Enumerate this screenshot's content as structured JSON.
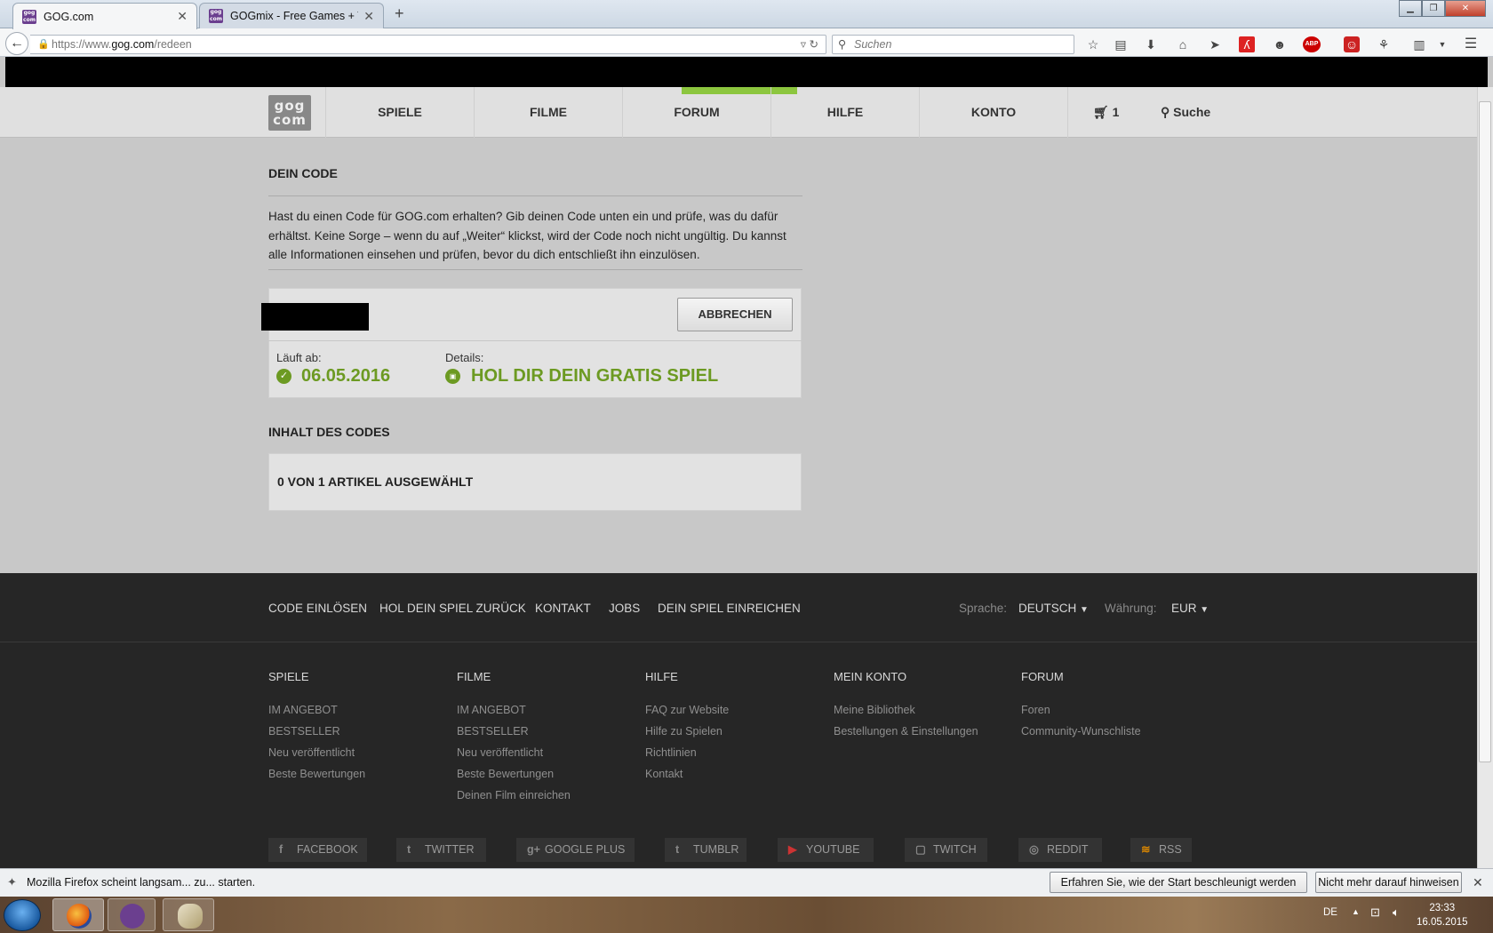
{
  "browser": {
    "tabs": [
      {
        "title": "GOG.com",
        "active": true
      },
      {
        "title": "GOGmix - Free Games + Te...",
        "active": false
      }
    ],
    "url_scheme": "https://www.",
    "url_host": "gog.com",
    "url_path": "/redeen",
    "search_placeholder": "Suchen",
    "toolbar_icons": [
      "star-icon",
      "reading-list-icon",
      "download-icon",
      "home-icon",
      "send-icon",
      "pdf-icon",
      "chat-icon",
      "adblock-icon",
      "extension-icon",
      "extension-icon",
      "clipboard-icon",
      "menu-icon"
    ],
    "abp_label": "ABP"
  },
  "gog": {
    "logo_top": "gog",
    "logo_bottom": "com",
    "nav": [
      "SPIELE",
      "FILME",
      "FORUM",
      "HILFE",
      "KONTO"
    ],
    "cart_count": "1",
    "search_label": "Suche"
  },
  "redeem": {
    "title": "DEIN CODE",
    "intro": "Hast du einen Code für GOG.com erhalten? Gib deinen Code unten ein und prüfe, was du dafür erhältst. Keine Sorge – wenn du auf „Weiter“ klickst, wird der Code noch nicht ungültig. Du kannst alle Informationen einsehen und prüfen, bevor du dich entschließt ihn einzulösen.",
    "cancel_button": "ABBRECHEN",
    "expires_label": "Läuft ab:",
    "expires_value": "06.05.2016",
    "details_label": "Details:",
    "details_value": "HOL DIR DEIN GRATIS SPIEL",
    "contents_title": "INHALT DES CODES",
    "selected_text": "0 VON 1 ARTIKEL AUSGEWÄHLT"
  },
  "footer": {
    "links": [
      "CODE EINLÖSEN",
      "HOL DEIN SPIEL ZURÜCK",
      "KONTAKT",
      "JOBS",
      "DEIN SPIEL EINREICHEN"
    ],
    "language_label": "Sprache:",
    "language_value": "DEUTSCH",
    "currency_label": "Währung:",
    "currency_value": "EUR",
    "columns": [
      {
        "title": "SPIELE",
        "items": [
          "IM ANGEBOT",
          "BESTSELLER",
          "Neu veröffentlicht",
          "Beste Bewertungen"
        ]
      },
      {
        "title": "FILME",
        "items": [
          "IM ANGEBOT",
          "BESTSELLER",
          "Neu veröffentlicht",
          "Beste Bewertungen",
          "Deinen Film einreichen"
        ]
      },
      {
        "title": "HILFE",
        "items": [
          "FAQ zur Website",
          "Hilfe zu Spielen",
          "Richtlinien",
          "Kontakt"
        ]
      },
      {
        "title": "MEIN KONTO",
        "items": [
          "Meine Bibliothek",
          "Bestellungen & Einstellungen"
        ]
      },
      {
        "title": "FORUM",
        "items": [
          "Foren",
          "Community-Wunschliste"
        ]
      }
    ],
    "social": [
      {
        "label": "FACEBOOK",
        "icon": "f"
      },
      {
        "label": "TWITTER",
        "icon": "t"
      },
      {
        "label": "GOOGLE PLUS",
        "icon": "g+"
      },
      {
        "label": "TUMBLR",
        "icon": "t"
      },
      {
        "label": "YOUTUBE",
        "icon": "▶"
      },
      {
        "label": "TWITCH",
        "icon": "▢"
      },
      {
        "label": "REDDIT",
        "icon": "◎"
      },
      {
        "label": "RSS",
        "icon": "≋"
      }
    ]
  },
  "notification": {
    "text": "Mozilla Firefox scheint langsam... zu... starten.",
    "button1": "Erfahren Sie, wie der Start beschleunigt werden kann",
    "button2": "Nicht mehr darauf hinweisen"
  },
  "taskbar": {
    "lang": "DE",
    "time": "23:33",
    "date": "16.05.2015"
  }
}
